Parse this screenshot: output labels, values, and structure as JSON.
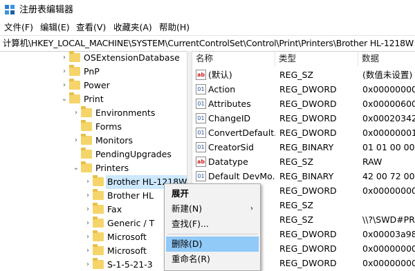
{
  "window": {
    "title": "注册表编辑器"
  },
  "menu": [
    "文件(F)",
    "编辑(E)",
    "查看(V)",
    "收藏夹(A)",
    "帮助(H)"
  ],
  "address": "计算机\\HKEY_LOCAL_MACHINE\\SYSTEM\\CurrentControlSet\\Control\\Print\\Printers\\Brother HL-1218W",
  "tree": [
    {
      "label": "OSExtensionDatabase",
      "arrow": "›",
      "level": 0
    },
    {
      "label": "PnP",
      "arrow": "›",
      "level": 0
    },
    {
      "label": "Power",
      "arrow": "›",
      "level": 0
    },
    {
      "label": "Print",
      "arrow": "⌄",
      "level": 0
    },
    {
      "label": "Environments",
      "arrow": "›",
      "level": 1
    },
    {
      "label": "Forms",
      "arrow": "",
      "level": 1
    },
    {
      "label": "Monitors",
      "arrow": "›",
      "level": 1
    },
    {
      "label": "PendingUpgrades",
      "arrow": "",
      "level": 1
    },
    {
      "label": "Printers",
      "arrow": "⌄",
      "level": 1
    },
    {
      "label": "Brother HL-1218W",
      "arrow": "›",
      "level": 2,
      "selected": true
    },
    {
      "label": "Brother HL",
      "arrow": "›",
      "level": 2
    },
    {
      "label": "Fax",
      "arrow": "›",
      "level": 2
    },
    {
      "label": "Generic / T",
      "arrow": "›",
      "level": 2
    },
    {
      "label": "Microsoft",
      "arrow": "›",
      "level": 2
    },
    {
      "label": "Microsoft",
      "arrow": "›",
      "level": 2
    },
    {
      "label": "S-1-5-21-3",
      "arrow": "›",
      "level": 2
    }
  ],
  "columns": {
    "name": "名称",
    "type": "类型",
    "data": "数据"
  },
  "values": [
    {
      "icon": "ab",
      "name": "(默认)",
      "type": "REG_SZ",
      "data": "(数值未设置)"
    },
    {
      "icon": "01",
      "name": "Action",
      "type": "REG_DWORD",
      "data": "0x00000000 ("
    },
    {
      "icon": "01",
      "name": "Attributes",
      "type": "REG_DWORD",
      "data": "0x00000600 ("
    },
    {
      "icon": "01",
      "name": "ChangeID",
      "type": "REG_DWORD",
      "data": "0x00020342 ("
    },
    {
      "icon": "01",
      "name": "ConvertDefault...",
      "type": "REG_DWORD",
      "data": "0x00000001 ("
    },
    {
      "icon": "01",
      "name": "CreatorSid",
      "type": "REG_BINARY",
      "data": "01 01 00 00 0"
    },
    {
      "icon": "ab",
      "name": "Datatype",
      "type": "REG_SZ",
      "data": "RAW"
    },
    {
      "icon": "01",
      "name": "Default DevMo...",
      "type": "REG_BINARY",
      "data": "42 00 72 00 6"
    },
    {
      "icon": "01",
      "name": "ty",
      "type": "REG_DWORD",
      "data": "0x00000000 ("
    },
    {
      "icon": "",
      "name": "",
      "type": "REG_SZ",
      "data": ""
    },
    {
      "icon": "",
      "name": "c.",
      "type": "REG_SZ",
      "data": "\\\\?\\SWD#PRI"
    },
    {
      "icon": "",
      "name": "",
      "type": "REG_DWORD",
      "data": "0x00003a98 ("
    },
    {
      "icon": "",
      "name": "",
      "type": "REG_DWORD",
      "data": "0x00000000 ("
    },
    {
      "icon": "",
      "name": "F.",
      "type": "REG_DWORD",
      "data": "0x00000000 ("
    }
  ],
  "context_menu": [
    {
      "label": "展开",
      "bold": true
    },
    {
      "label": "新建(N)",
      "submenu": true
    },
    {
      "label": "查找(F)..."
    },
    {
      "label": "删除(D)",
      "hover": true
    },
    {
      "label": "重命名(R)"
    }
  ]
}
